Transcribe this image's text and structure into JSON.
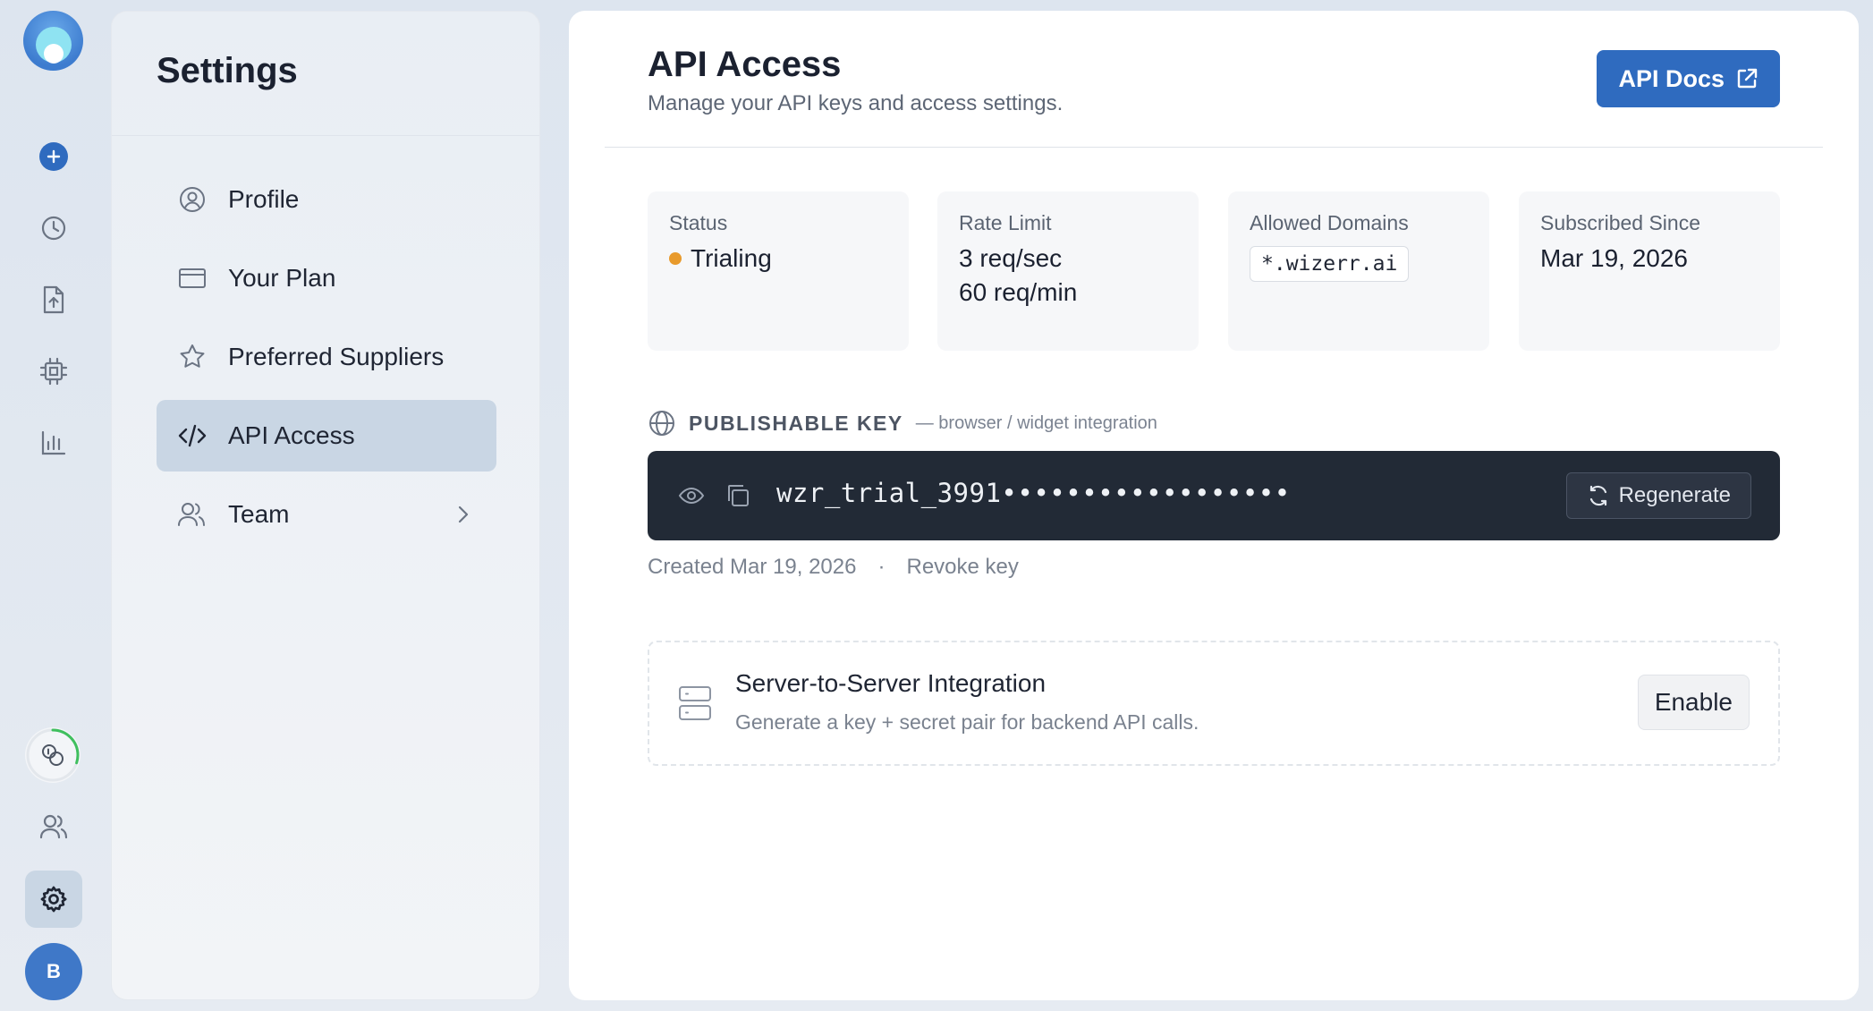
{
  "sidebar_rail": {
    "icons": [
      "logo-icon",
      "new-plus-icon",
      "history-clock-icon",
      "file-upload-icon",
      "cpu-chip-icon",
      "analytics-chart-icon",
      "usage-credits-icon",
      "team-users-icon",
      "settings-gear-icon"
    ],
    "avatar_initial": "B",
    "active": "settings-gear-icon",
    "usage_progress": 0.3
  },
  "settings": {
    "title": "Settings",
    "items": [
      {
        "label": "Profile",
        "icon": "user-circle-icon"
      },
      {
        "label": "Your Plan",
        "icon": "credit-card-icon"
      },
      {
        "label": "Preferred Suppliers",
        "icon": "star-icon"
      },
      {
        "label": "API Access",
        "icon": "code-icon",
        "active": true
      },
      {
        "label": "Team",
        "icon": "users-icon",
        "has_chevron": true
      }
    ]
  },
  "header": {
    "title": "API Access",
    "subtitle": "Manage your API keys and access settings.",
    "docs_button": "API Docs"
  },
  "stats": {
    "status": {
      "label": "Status",
      "value": "Trialing",
      "color": "#e89a2c"
    },
    "rate_limit": {
      "label": "Rate Limit",
      "line1": "3 req/sec",
      "line2": "60 req/min"
    },
    "domains": {
      "label": "Allowed Domains",
      "value": "*.wizerr.ai"
    },
    "subscribed": {
      "label": "Subscribed Since",
      "value": "Mar 19, 2026"
    }
  },
  "publishable_key": {
    "title": "PUBLISHABLE KEY",
    "subtitle": "— browser / widget integration",
    "masked_value": "wzr_trial_3991••••••••••••••••••",
    "regenerate_label": "Regenerate",
    "created": "Created Mar 19, 2026",
    "separator": "·",
    "revoke_label": "Revoke key"
  },
  "server_to_server": {
    "title": "Server-to-Server Integration",
    "subtitle": "Generate a key + secret pair for backend API calls.",
    "button": "Enable"
  },
  "colors": {
    "accent": "#2f6bbf",
    "key_bar": "#222a36",
    "status_dot": "#e89a2c",
    "active_nav": "#c9d6e4"
  }
}
